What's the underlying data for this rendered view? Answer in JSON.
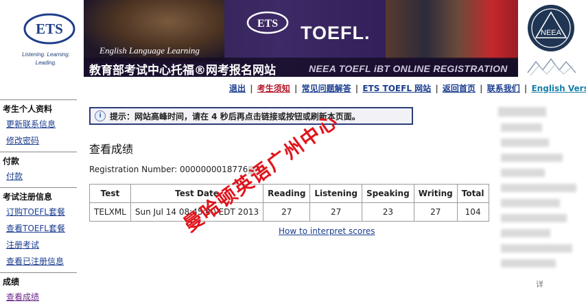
{
  "header": {
    "ets_logo": "ETS",
    "ets_tagline_1": "Listening. Learning.",
    "ets_tagline_2": "Leading.",
    "banner_ets": "ETS",
    "banner_toefl": "TOEFL.",
    "banner_ell": "English Language Learning",
    "banner_cn_title": "教育部考试中心托福®网考报名网站",
    "banner_en_title": "NEEA TOEFL iBT ONLINE REGISTRATION",
    "neea_logo": "NEEA"
  },
  "top_nav": {
    "logout": "退出",
    "notice": "考生须知",
    "faq": "常见问题解答",
    "ets_toefl": "ETS TOEFL 网站",
    "home": "返回首页",
    "contact": "联系我们",
    "english": "English Version",
    "separator": "|"
  },
  "sidebar": {
    "personal": {
      "title": "考生个人资料",
      "items": [
        "更新联系信息",
        "修改密码"
      ]
    },
    "payment": {
      "title": "付款",
      "items": [
        "付款"
      ]
    },
    "exam_reg": {
      "title": "考试注册信息",
      "items": [
        "订购TOEFL套餐",
        "查看TOEFL套餐",
        "注册考试",
        "查看已注册信息"
      ]
    },
    "scores": {
      "title": "成绩",
      "items": [
        "查看成绩"
      ]
    }
  },
  "notice": {
    "icon": "info-icon",
    "text": "提示：网站高峰时间，请在 4 秒后再点击链接或按钮或刷新本页面。"
  },
  "main": {
    "title": "查看成绩",
    "reg_label": "Registration Number: ",
    "reg_value": "0000000018776",
    "table": {
      "headers": [
        "Test",
        "Test Date",
        "Reading",
        "Listening",
        "Speaking",
        "Writing",
        "Total"
      ],
      "rows": [
        [
          "TELXML",
          "Sun Jul 14 08:45:40 EDT 2013",
          "27",
          "27",
          "23",
          "27",
          "104"
        ]
      ]
    },
    "interpret_link": "How to interpret scores"
  },
  "watermark": "曼哈顿英语广州中心",
  "right_panel_tail": "详",
  "colors": {
    "nav_link": "#1a3d8f",
    "nav_highlight": "#b4162a",
    "banner_bg": "#3d2a66",
    "notice_border": "#2b3c7a",
    "watermark": "#e1141c"
  }
}
